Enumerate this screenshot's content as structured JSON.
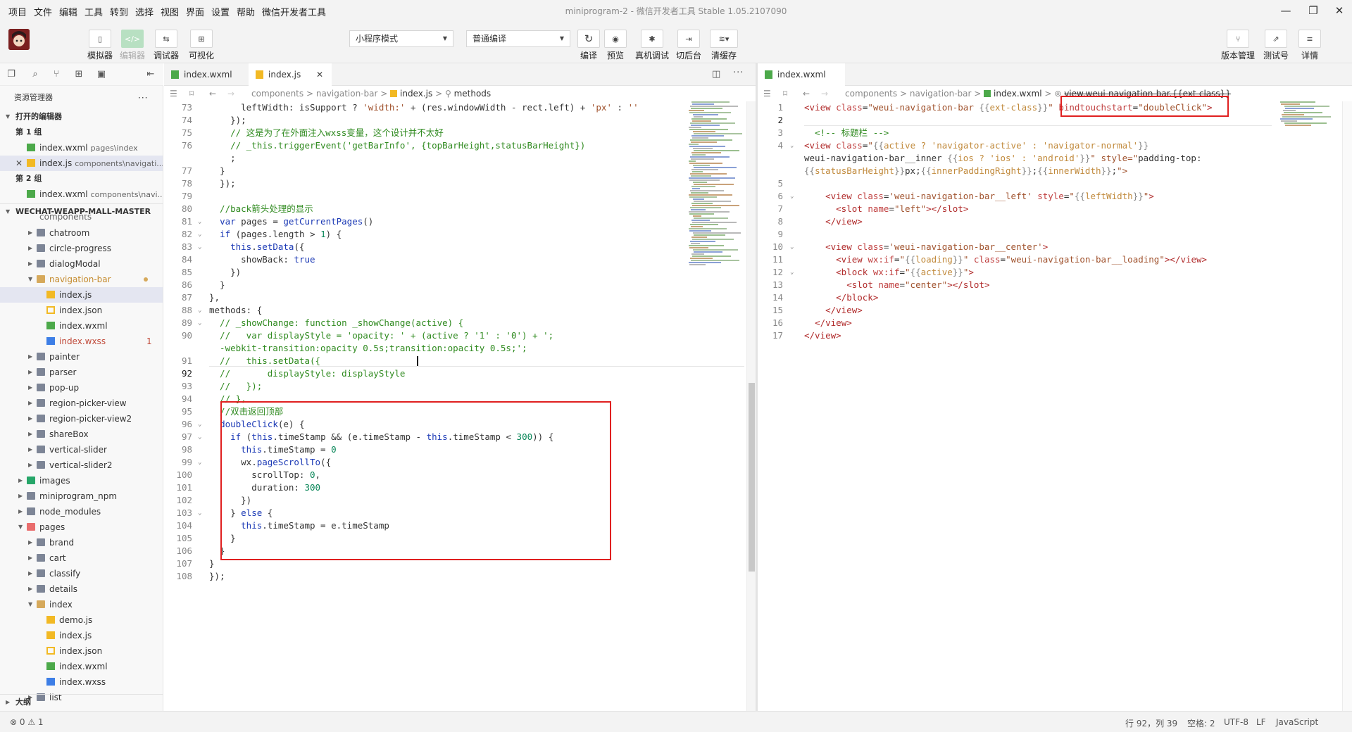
{
  "menu": [
    "项目",
    "文件",
    "编辑",
    "工具",
    "转到",
    "选择",
    "视图",
    "界面",
    "设置",
    "帮助",
    "微信开发者工具"
  ],
  "window_title": "miniprogram-2 - 微信开发者工具 Stable 1.05.2107090",
  "toolbar": {
    "simulator": "模拟器",
    "editor": "编辑器",
    "debugger": "调试器",
    "visual": "可视化",
    "mode": "小程序模式",
    "compile_mode": "普通编译",
    "compile": "编译",
    "preview": "预览",
    "real_debug": "真机调试",
    "backstage": "切后台",
    "clear_cache": "清缓存",
    "version": "版本管理",
    "test": "测试号",
    "details": "详情"
  },
  "explorer": {
    "title": "资源管理器",
    "open_editors": "打开的编辑器",
    "group1": "第 1 组",
    "group2": "第 2 组",
    "open1_name": "index.wxml",
    "open1_path": "pages\\index",
    "open2_name": "index.js",
    "open2_path": "components\\navigati...",
    "open3_name": "index.wxml",
    "open3_path": "components\\navi...",
    "project": "WECHAT-WEAPP-MALL-MASTER",
    "components": "components",
    "tree": [
      "chatroom",
      "circle-progress",
      "dialogModal",
      "navigation-bar",
      "index.js",
      "index.json",
      "index.wxml",
      "index.wxss",
      "painter",
      "parser",
      "pop-up",
      "region-picker-view",
      "region-picker-view2",
      "shareBox",
      "vertical-slider",
      "vertical-slider2",
      "images",
      "miniprogram_npm",
      "node_modules",
      "pages",
      "brand",
      "cart",
      "classify",
      "details",
      "index",
      "demo.js",
      "index.js",
      "index.json",
      "index.wxml",
      "index.wxss",
      "list"
    ],
    "wxss_badge": "1",
    "outline": "大纲"
  },
  "editor_left": {
    "tab1": "index.wxml",
    "tab2": "index.js",
    "breadcrumb": [
      "components",
      ">",
      "navigation-bar",
      ">",
      "index.js",
      ">",
      "methods"
    ],
    "line_numbers": [
      "73",
      "74",
      "75",
      "76",
      "77",
      "78",
      "79",
      "80",
      "81",
      "82",
      "83",
      "84",
      "85",
      "86",
      "87",
      "88",
      "89",
      "90",
      "91",
      "92",
      "93",
      "94",
      "95",
      "96",
      "97",
      "98",
      "99",
      "100",
      "101",
      "102",
      "103",
      "104",
      "105",
      "106",
      "107",
      "108"
    ],
    "lines": [
      "      leftWidth: isSupport ? 'width:' + (res.windowWidth - rect.left) + 'px' : ''",
      "    });",
      "    // 这是为了在外面注入wxss变量，这个设计并不太好",
      "    // _this.triggerEvent('getBarInfo', {topBarHeight,statusBarHeight})",
      "    ;",
      "  }",
      "  });",
      "",
      "  //back箭头处理的显示",
      "  var pages = getCurrentPages()",
      "  if (pages.length > 1) {",
      "    this.setData({",
      "      showBack: true",
      "    })",
      "  }",
      "},",
      "methods: {",
      "  // _showChange: function _showChange(active) {",
      "  //   var displayStyle = 'opacity: ' + (active ? '1' : '0') + ';",
      "  -webkit-transition:opacity 0.5s;transition:opacity 0.5s;';",
      "  //   this.setData({",
      "  //       displayStyle: displayStyle",
      "  //   });",
      "  // },",
      "  //双击返回顶部",
      "  doubleClick(e) {",
      "    if (this.timeStamp && (e.timeStamp - this.timeStamp < 300)) {",
      "      this.timeStamp = 0",
      "      wx.pageScrollTo({",
      "        scrollTop: 0,",
      "        duration: 300",
      "      })",
      "    } else {",
      "      this.timeStamp = e.timeStamp",
      "    }",
      "  }",
      "}",
      "});"
    ]
  },
  "editor_right": {
    "tab": "index.wxml",
    "breadcrumb": [
      "components",
      ">",
      "navigation-bar",
      ">",
      "index.wxml",
      ">",
      "view.weui-navigation-bar.{{ext-class}}"
    ],
    "line_numbers": [
      "1",
      "2",
      "3",
      "4",
      "5",
      "6",
      "7",
      "8",
      "9",
      "10",
      "11",
      "12",
      "13",
      "14",
      "15",
      "16",
      "17"
    ],
    "lines": [
      "<view class=\"weui-navigation-bar {{ext-class}}\" bindtouchstart=\"doubleClick\">",
      "",
      "  <!-- 标题栏 -->",
      "<view class=\"{{active ? 'navigator-active' : 'navigator-normal'}}",
      "weui-navigation-bar__inner {{ios ? 'ios' : 'android'}}\" style=\"padding-top:",
      "{{statusBarHeight}}px;{{innerPaddingRight}};{{innerWidth}};\">",
      "",
      "    <view class='weui-navigation-bar__left' style=\"{{leftWidth}}\">",
      "      <slot name=\"left\"></slot>",
      "    </view>",
      "",
      "    <view class='weui-navigation-bar__center'>",
      "      <view wx:if=\"{{loading}}\" class=\"weui-navigation-bar__loading\"></view>",
      "      <block wx:if=\"{{active}}\">",
      "        <slot name=\"center\"></slot>",
      "      </block>",
      "    </view>",
      "  </view>",
      "</view>"
    ]
  },
  "status": {
    "errors": "⊗ 0 ⚠ 1",
    "position": "行 92，列 39",
    "spaces": "空格: 2",
    "encoding": "UTF-8",
    "eol": "LF",
    "language": "JavaScript"
  },
  "colors": {
    "highlight": "#e02020",
    "selection": "#e4e6f1",
    "keyword": "#1b39b5",
    "string": "#a0522d",
    "comment": "#2f8a1f",
    "tag": "#b02a2a"
  },
  "icons": [
    "mobile-icon",
    "code-icon",
    "sliders-icon",
    "layout-icon",
    "refresh-icon",
    "eye-icon",
    "bug-icon",
    "switch-icon",
    "layers-icon",
    "branch-icon",
    "external-link-icon",
    "menu-icon",
    "files-icon",
    "search-icon",
    "source-control-icon",
    "extensions-icon",
    "split-icon",
    "more-icon",
    "back-arrow-icon",
    "forward-arrow-icon"
  ]
}
